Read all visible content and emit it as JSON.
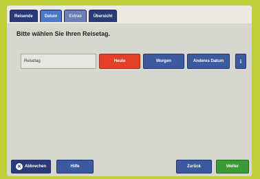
{
  "tabs": [
    {
      "label": "Reisende"
    },
    {
      "label": "Datum"
    },
    {
      "label": "Extras"
    },
    {
      "label": "Übersicht"
    }
  ],
  "title": "Bitte wählen Sie Ihren Reisetag.",
  "reisetag": {
    "label": "Reisetag",
    "options": [
      {
        "label": "Heute",
        "selected": true
      },
      {
        "label": "Morgen",
        "selected": false
      },
      {
        "label": "Anderes Datum",
        "selected": false
      }
    ],
    "info_label": "i"
  },
  "footer": {
    "cancel_label": "Abbrechen",
    "help_label": "Hilfe",
    "back_label": "Zurück",
    "next_label": "Weiter"
  }
}
